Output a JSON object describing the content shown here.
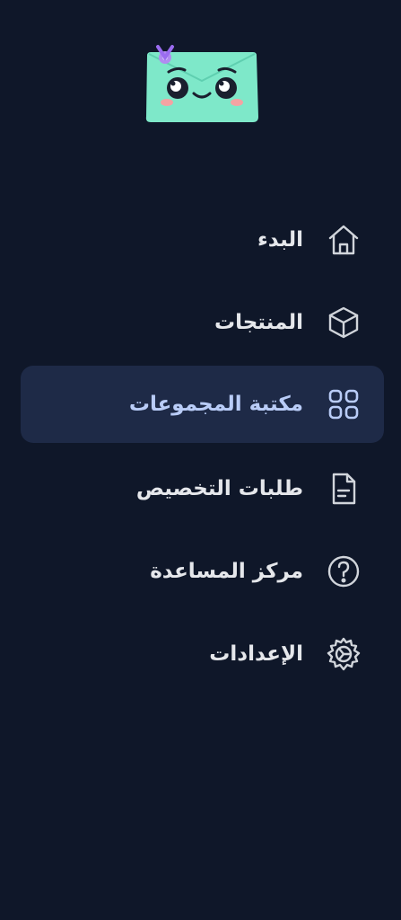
{
  "app": {
    "logo_icon": "envelope-mascot-icon"
  },
  "nav": {
    "items": [
      {
        "label": "البدء",
        "icon": "home-icon",
        "active": false
      },
      {
        "label": "المنتجات",
        "icon": "box-icon",
        "active": false
      },
      {
        "label": "مكتبة المجموعات",
        "icon": "grid-icon",
        "active": true
      },
      {
        "label": "طلبات التخصيص",
        "icon": "document-icon",
        "active": false
      },
      {
        "label": "مركز المساعدة",
        "icon": "help-icon",
        "active": false
      },
      {
        "label": "الإعدادات",
        "icon": "gear-icon",
        "active": false
      }
    ]
  },
  "colors": {
    "background": "#0f1729",
    "active_background": "#1e2a47",
    "active_text": "#b9ccf7",
    "text": "#e5e7eb",
    "logo_mint": "#7ee8c9"
  }
}
